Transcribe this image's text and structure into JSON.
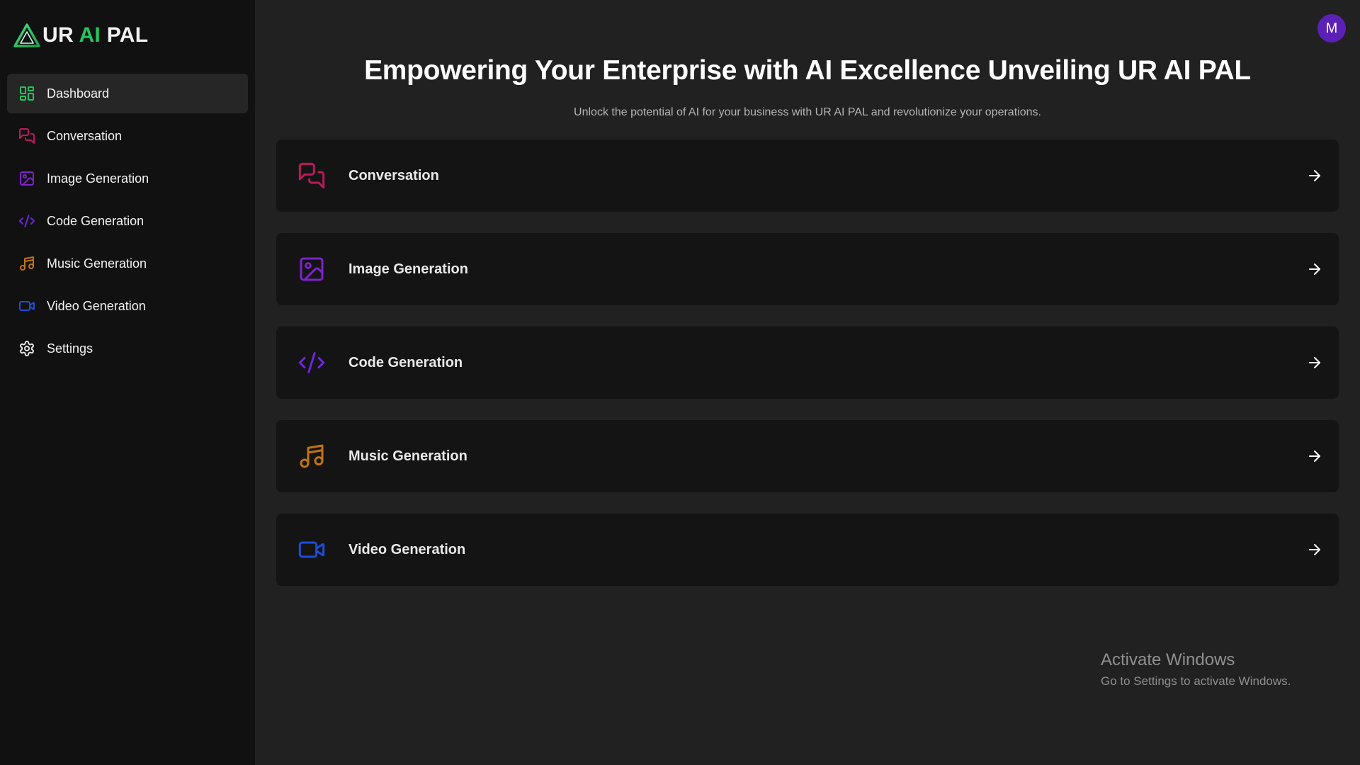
{
  "app": {
    "logo_prefix": "UR ",
    "logo_accent": "AI",
    "logo_suffix": " PAL"
  },
  "colors": {
    "accent_green": "#22c55e",
    "conversation": "#be185d",
    "image": "#7e22ce",
    "code": "#6d28d9",
    "music": "#c2740c",
    "video": "#1d4ed8",
    "avatar_bg": "#5b21b6"
  },
  "sidebar": {
    "items": [
      {
        "label": "Dashboard",
        "icon": "dashboard-icon",
        "active": true
      },
      {
        "label": "Conversation",
        "icon": "message-icon"
      },
      {
        "label": "Image Generation",
        "icon": "image-icon"
      },
      {
        "label": "Code Generation",
        "icon": "code-icon"
      },
      {
        "label": "Music Generation",
        "icon": "music-icon"
      },
      {
        "label": "Video Generation",
        "icon": "video-icon"
      },
      {
        "label": "Settings",
        "icon": "gear-icon"
      }
    ]
  },
  "header": {
    "avatar_initial": "M"
  },
  "main": {
    "title": "Empowering Your Enterprise with AI Excellence Unveiling UR AI PAL",
    "subtitle": "Unlock the potential of AI for your business with UR AI PAL and revolutionize your operations.",
    "cards": [
      {
        "label": "Conversation",
        "icon": "message-icon"
      },
      {
        "label": "Image Generation",
        "icon": "image-icon"
      },
      {
        "label": "Code Generation",
        "icon": "code-icon"
      },
      {
        "label": "Music Generation",
        "icon": "music-icon"
      },
      {
        "label": "Video Generation",
        "icon": "video-icon"
      }
    ]
  },
  "watermark": {
    "title": "Activate Windows",
    "subtitle": "Go to Settings to activate Windows."
  }
}
